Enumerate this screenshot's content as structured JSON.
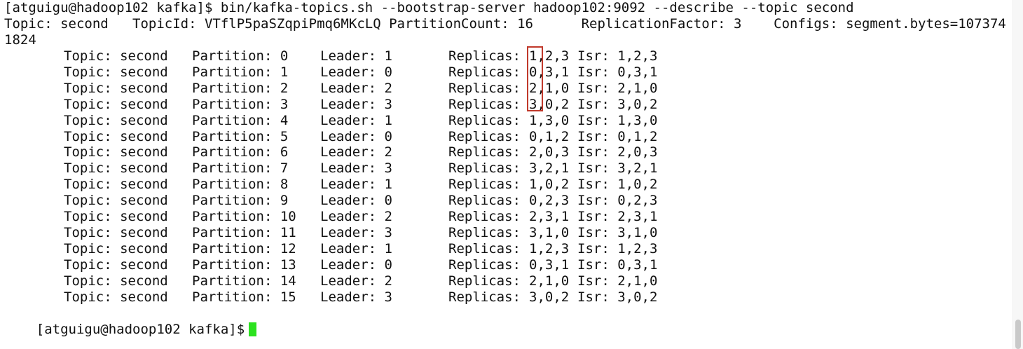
{
  "terminal": {
    "command_line": "[atguigu@hadoop102 kafka]$ bin/kafka-topics.sh --bootstrap-server hadoop102:9092 --describe --topic second",
    "summary_line": "Topic: second   TopicId: VTflP5paSZqpiPmq6MKcLQ PartitionCount: 16      ReplicationFactor: 3    Configs: segment.bytes=107374",
    "summary_wrap": "1824",
    "partitions": [
      {
        "topic": "Topic: second",
        "partition": "Partition: 0",
        "leader": "Leader: 1",
        "replicas_label": "Replicas: ",
        "replicas": "1,2,3",
        "isr": "Isr: 1,2,3"
      },
      {
        "topic": "Topic: second",
        "partition": "Partition: 1",
        "leader": "Leader: 0",
        "replicas_label": "Replicas: ",
        "replicas": "0,3,1",
        "isr": "Isr: 0,3,1"
      },
      {
        "topic": "Topic: second",
        "partition": "Partition: 2",
        "leader": "Leader: 2",
        "replicas_label": "Replicas: ",
        "replicas": "2,1,0",
        "isr": "Isr: 2,1,0"
      },
      {
        "topic": "Topic: second",
        "partition": "Partition: 3",
        "leader": "Leader: 3",
        "replicas_label": "Replicas: ",
        "replicas": "3,0,2",
        "isr": "Isr: 3,0,2"
      },
      {
        "topic": "Topic: second",
        "partition": "Partition: 4",
        "leader": "Leader: 1",
        "replicas_label": "Replicas: ",
        "replicas": "1,3,0",
        "isr": "Isr: 1,3,0"
      },
      {
        "topic": "Topic: second",
        "partition": "Partition: 5",
        "leader": "Leader: 0",
        "replicas_label": "Replicas: ",
        "replicas": "0,1,2",
        "isr": "Isr: 0,1,2"
      },
      {
        "topic": "Topic: second",
        "partition": "Partition: 6",
        "leader": "Leader: 2",
        "replicas_label": "Replicas: ",
        "replicas": "2,0,3",
        "isr": "Isr: 2,0,3"
      },
      {
        "topic": "Topic: second",
        "partition": "Partition: 7",
        "leader": "Leader: 3",
        "replicas_label": "Replicas: ",
        "replicas": "3,2,1",
        "isr": "Isr: 3,2,1"
      },
      {
        "topic": "Topic: second",
        "partition": "Partition: 8",
        "leader": "Leader: 1",
        "replicas_label": "Replicas: ",
        "replicas": "1,0,2",
        "isr": "Isr: 1,0,2"
      },
      {
        "topic": "Topic: second",
        "partition": "Partition: 9",
        "leader": "Leader: 0",
        "replicas_label": "Replicas: ",
        "replicas": "0,2,3",
        "isr": "Isr: 0,2,3"
      },
      {
        "topic": "Topic: second",
        "partition": "Partition: 10",
        "leader": "Leader: 2",
        "replicas_label": "Replicas: ",
        "replicas": "2,3,1",
        "isr": "Isr: 2,3,1"
      },
      {
        "topic": "Topic: second",
        "partition": "Partition: 11",
        "leader": "Leader: 3",
        "replicas_label": "Replicas: ",
        "replicas": "3,1,0",
        "isr": "Isr: 3,1,0"
      },
      {
        "topic": "Topic: second",
        "partition": "Partition: 12",
        "leader": "Leader: 1",
        "replicas_label": "Replicas: ",
        "replicas": "1,2,3",
        "isr": "Isr: 1,2,3"
      },
      {
        "topic": "Topic: second",
        "partition": "Partition: 13",
        "leader": "Leader: 0",
        "replicas_label": "Replicas: ",
        "replicas": "0,3,1",
        "isr": "Isr: 0,3,1"
      },
      {
        "topic": "Topic: second",
        "partition": "Partition: 14",
        "leader": "Leader: 2",
        "replicas_label": "Replicas: ",
        "replicas": "2,1,0",
        "isr": "Isr: 2,1,0"
      },
      {
        "topic": "Topic: second",
        "partition": "Partition: 15",
        "leader": "Leader: 3",
        "replicas_label": "Replicas: ",
        "replicas": "3,0,2",
        "isr": "Isr: 3,0,2"
      }
    ],
    "prompt": "[atguigu@hadoop102 kafka]$"
  },
  "colors": {
    "background": "#ffffff",
    "text": "#111111",
    "cursor": "#2ce21f",
    "highlight_border": "#c0392b"
  },
  "icons": {
    "cursor": "block-cursor-icon"
  }
}
